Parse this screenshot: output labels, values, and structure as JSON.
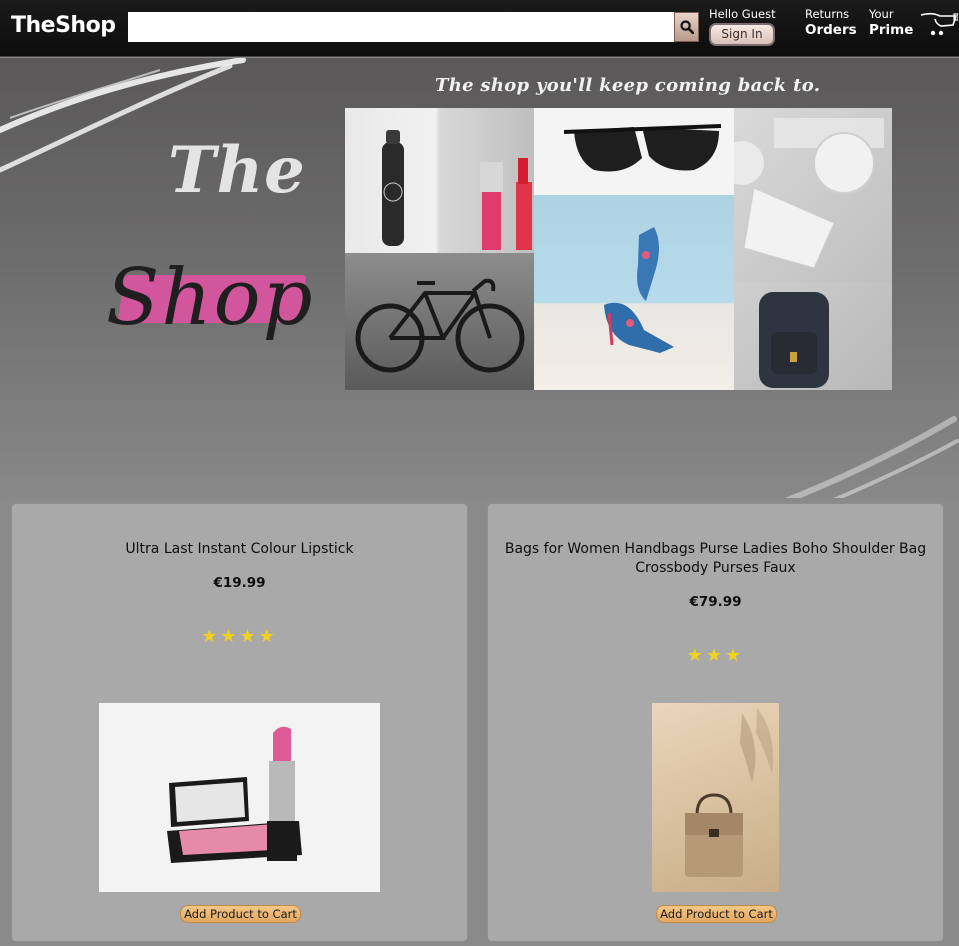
{
  "nav": {
    "logo": "TheShop",
    "search": {
      "value": "",
      "placeholder": ""
    },
    "search_icon": "search-icon",
    "greeting": "Hello Guest",
    "signin_label": "Sign In",
    "returns_label": "Returns",
    "orders_label": "Orders",
    "your_label": "Your",
    "prime_label": "Prime",
    "cart_icon": "cart-icon"
  },
  "hero": {
    "tagline": "The shop you'll keep coming back to.",
    "title_line1": "The",
    "title_line2": "Shop",
    "highlight_color": "#d1569b"
  },
  "products": [
    {
      "title": "Ultra Last Instant Colour Lipstick",
      "price": "€19.99",
      "stars": "★★★★",
      "rating": 4,
      "button_label": "Add Product to Cart"
    },
    {
      "title": "Bags for Women Handbags Purse Ladies Boho Shoulder Bag Crossbody Purses Faux",
      "price": "€79.99",
      "stars": "★★★",
      "rating": 3,
      "button_label": "Add Product to Cart"
    }
  ],
  "colors": {
    "nav_bg": "#111111",
    "page_bg": "#8a8a8a",
    "card_bg": "#a9a9a9",
    "star": "#f2d21f",
    "button": "#e9b575"
  }
}
